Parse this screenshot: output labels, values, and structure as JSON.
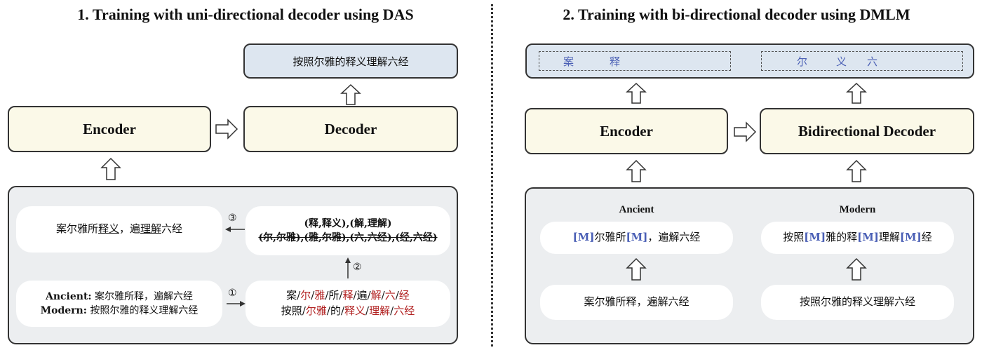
{
  "left": {
    "title": "1. Training with uni-directional decoder using DAS",
    "output_text": "按照尔雅的释义理解六经",
    "encoder_label": "Encoder",
    "decoder_label": "Decoder",
    "result_sentence": {
      "p1": "案尔雅所",
      "u1": "释义",
      "p2": "，遍",
      "u2": "理解",
      "p3": "六经"
    },
    "pairs_line1": "(释,释义),(解,理解)",
    "pairs_line2": "(尔,尔雅),(雅,尔雅),(六,六经),(经,六经)",
    "input_ancient_label": "Ancient:",
    "input_ancient_text": "案尔雅所释，遍解六经",
    "input_modern_label": "Modern:",
    "input_modern_text": "按照尔雅的释义理解六经",
    "seg_ancient": [
      {
        "t": "案",
        "red": false
      },
      {
        "t": "/",
        "red": false
      },
      {
        "t": "尔",
        "red": true
      },
      {
        "t": "/",
        "red": false
      },
      {
        "t": "雅",
        "red": true
      },
      {
        "t": "/",
        "red": false
      },
      {
        "t": "所",
        "red": false
      },
      {
        "t": "/",
        "red": false
      },
      {
        "t": "释",
        "red": true
      },
      {
        "t": "/",
        "red": false
      },
      {
        "t": "遍",
        "red": false
      },
      {
        "t": "/",
        "red": false
      },
      {
        "t": "解",
        "red": true
      },
      {
        "t": "/",
        "red": false
      },
      {
        "t": "六",
        "red": true
      },
      {
        "t": "/",
        "red": false
      },
      {
        "t": "经",
        "red": true
      }
    ],
    "seg_modern": [
      {
        "t": "按照",
        "red": false
      },
      {
        "t": "/",
        "red": false
      },
      {
        "t": "尔雅",
        "red": true
      },
      {
        "t": "/",
        "red": false
      },
      {
        "t": "的",
        "red": false
      },
      {
        "t": "/",
        "red": false
      },
      {
        "t": "释义",
        "red": true
      },
      {
        "t": "/",
        "red": false
      },
      {
        "t": "理解",
        "red": true
      },
      {
        "t": "/",
        "red": false
      },
      {
        "t": "六经",
        "red": true
      }
    ],
    "step1": "①",
    "step2": "②",
    "step3": "③"
  },
  "right": {
    "title": "2. Training with bi-directional decoder using DMLM",
    "out_left": [
      "案",
      "释"
    ],
    "out_right": [
      "尔",
      "义",
      "六"
    ],
    "encoder_label": "Encoder",
    "decoder_label": "Bidirectional Decoder",
    "ancient_label": "Ancient",
    "modern_label": "Modern",
    "mask_token": "[M]",
    "ancient_masked": [
      {
        "t": "[M]",
        "m": true
      },
      {
        "t": "尔雅所",
        "m": false
      },
      {
        "t": "[M]",
        "m": true
      },
      {
        "t": "，遍解六经",
        "m": false
      }
    ],
    "modern_masked": [
      {
        "t": "按照",
        "m": false
      },
      {
        "t": "[M]",
        "m": true
      },
      {
        "t": "雅的释",
        "m": false
      },
      {
        "t": "[M]",
        "m": true
      },
      {
        "t": "理解",
        "m": false
      },
      {
        "t": "[M]",
        "m": true
      },
      {
        "t": "经",
        "m": false
      }
    ],
    "ancient_input": "案尔雅所释，遍解六经",
    "modern_input": "按照尔雅的释义理解六经"
  },
  "colors": {
    "highlight_red": "#b22222",
    "mask_blue": "#4a5fb5",
    "panel_gray": "#eceef0",
    "encoder_yellow": "#fbf9e8",
    "output_blue": "#dde6f0"
  }
}
